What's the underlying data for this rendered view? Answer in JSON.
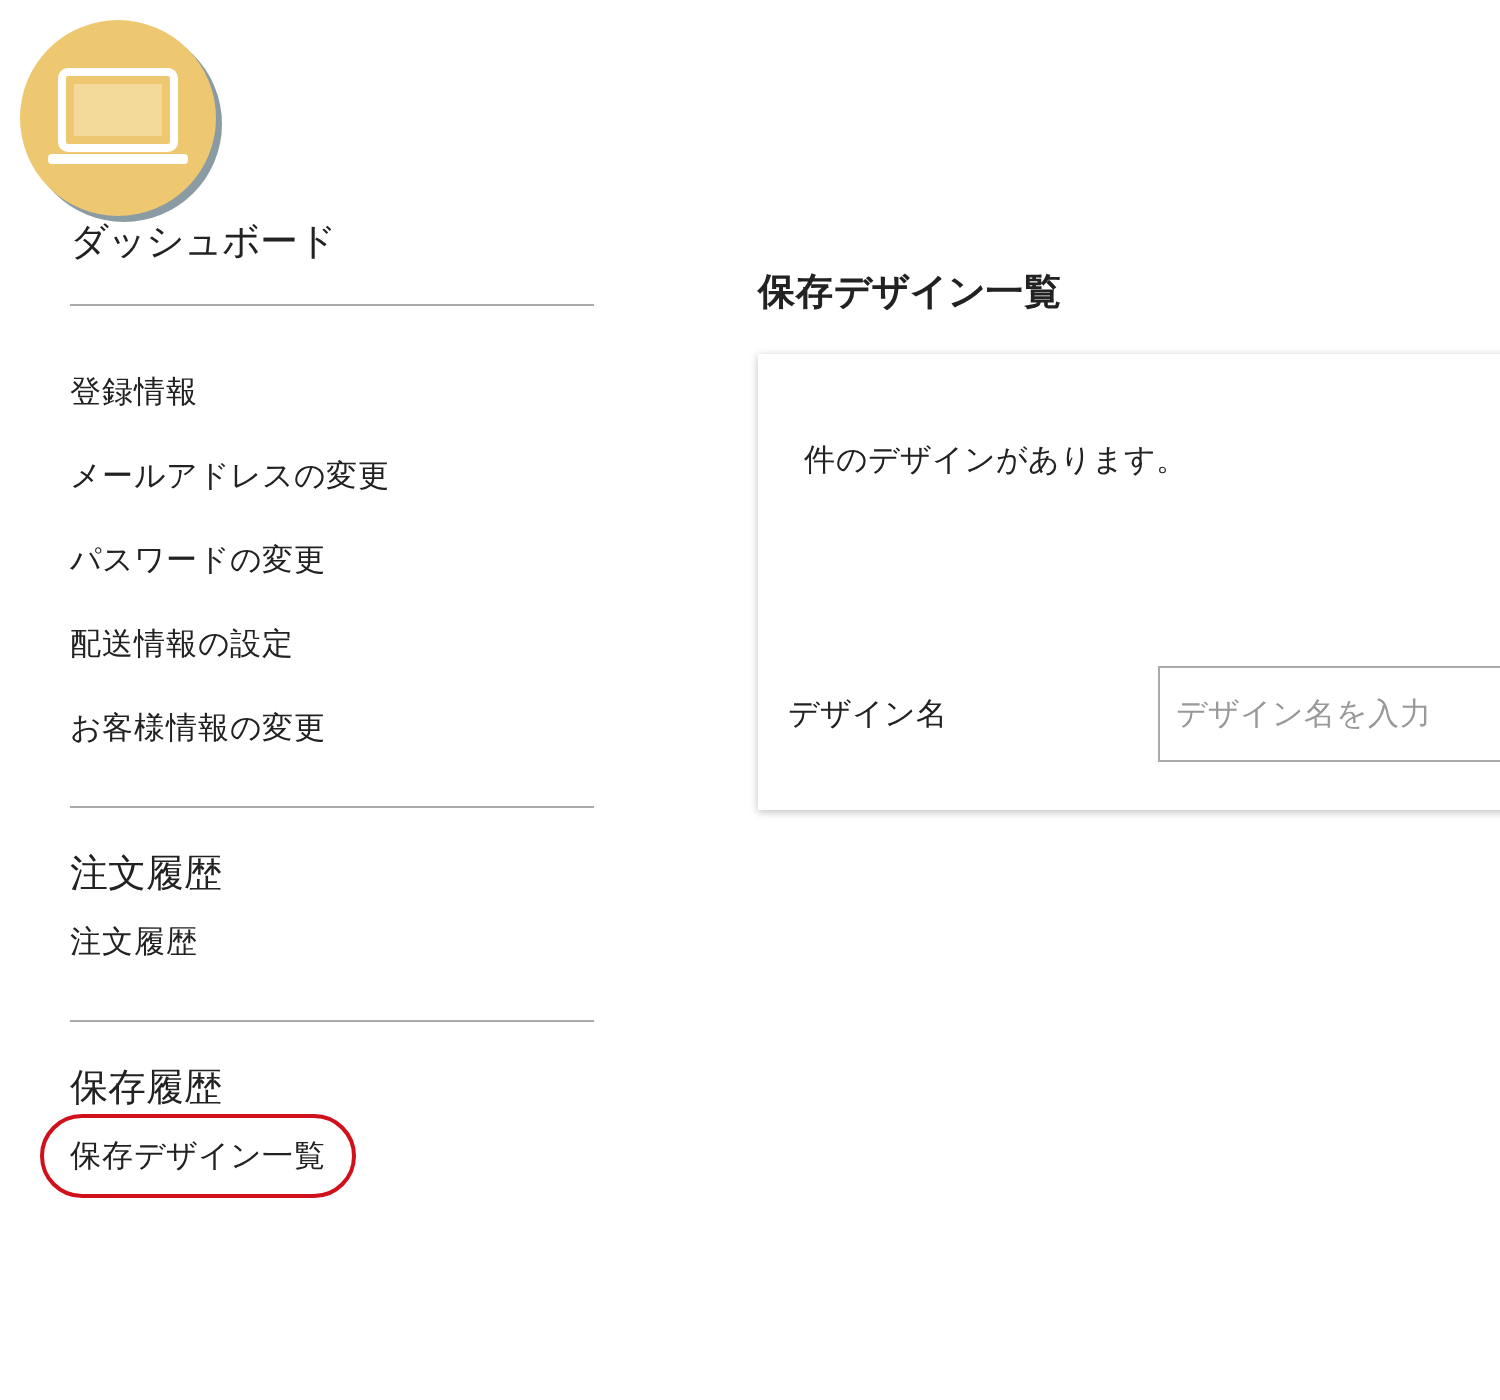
{
  "sidebar": {
    "sections": [
      {
        "heading": "ダッシュボード",
        "items": [
          {
            "label": "登録情報",
            "selected": false
          },
          {
            "label": "メールアドレスの変更",
            "selected": false
          },
          {
            "label": "パスワードの変更",
            "selected": false
          },
          {
            "label": "配送情報の設定",
            "selected": false
          },
          {
            "label": "お客様情報の変更",
            "selected": false
          }
        ]
      },
      {
        "heading": "注文履歴",
        "items": [
          {
            "label": "注文履歴",
            "selected": false
          }
        ]
      },
      {
        "heading": "保存履歴",
        "items": [
          {
            "label": "保存デザイン一覧",
            "selected": true
          }
        ]
      }
    ]
  },
  "main": {
    "title": "保存デザイン一覧",
    "count_text": "件のデザインがあります。",
    "search": {
      "label": "デザイン名",
      "placeholder": "デザイン名を入力"
    }
  }
}
